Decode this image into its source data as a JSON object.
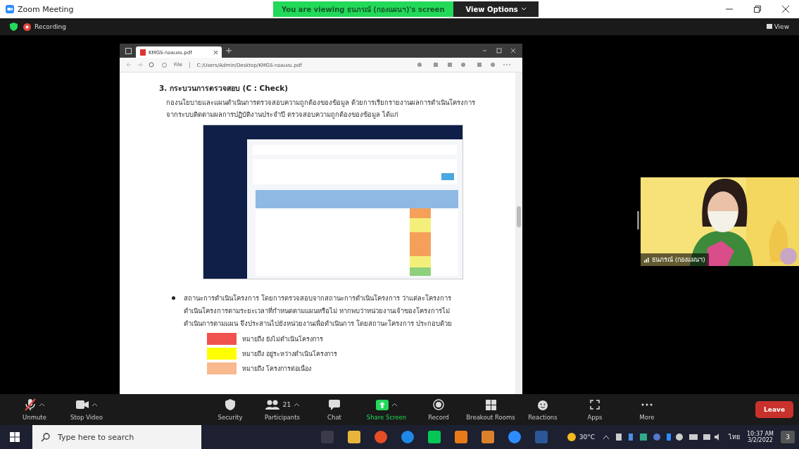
{
  "window": {
    "title": "Zoom Meeting"
  },
  "banner": {
    "text": "You are viewing ธนภรณ์ (กองแผนฯ)'s screen",
    "view_options": "View Options"
  },
  "recording": {
    "label": "Recording",
    "on": true
  },
  "view_button": "View",
  "shared_browser": {
    "tab_title": "KMGS-กองแผน.pdf",
    "address_prefix": "File",
    "address": "C:/Users/Admin/Desktop/KMGS-กองแผน.pdf",
    "document": {
      "heading": "3. กระบวนการตรวจสอบ (C : Check)",
      "paragraph_lines": [
        "กองนโยบายและแผนดำเนินการตรวจสอบความถูกต้องของข้อมูล ด้วยการเรียกรายงานผลการดำเนินโครงการ",
        "จากระบบติดตามผลการปฏิบัติงานประจำปี ตรวจสอบความถูกต้องของข้อมูล ได้แก่"
      ],
      "figure": {
        "kind": "picture"
      },
      "bullet_lines": [
        "สถานะการดำเนินโครงการ โดยการตรวจสอบจากสถานะการดำเนินโครงการ ว่าแต่ละโครงการ",
        "ดำเนินโครงการตามระยะเวลาที่กำหนดตามแผนหรือไม่ หากพบว่าหน่วยงานเจ้าของโครงการไม่",
        "ดำเนินการตามแผน จึงประสานไปยังหน่วยงานเพื่อดำเนินการ โดยสถานะโครงการ ประกอบด้วย"
      ],
      "legend": [
        {
          "color": "#f0524f",
          "label": "หมายถึง ยังไม่ดำเนินโครงการ"
        },
        {
          "color": "#ffff00",
          "label": "หมายถึง อยู่ระหว่างดำเนินโครงการ"
        },
        {
          "color": "#f9b98e",
          "label": "หมายถึง โครงการต่อเนื่อง"
        }
      ]
    }
  },
  "video_tile": {
    "name": "ธนภรณ์ (กองแผนฯ)"
  },
  "toolbar": [
    {
      "kind": "mic",
      "label": "Unmute",
      "muted": true,
      "caret": true
    },
    {
      "kind": "video",
      "label": "Stop Video",
      "caret": true
    },
    {
      "kind": "security",
      "label": "Security"
    },
    {
      "kind": "participants",
      "label": "Participants",
      "count": "21",
      "caret": true
    },
    {
      "kind": "chat",
      "label": "Chat"
    },
    {
      "kind": "share",
      "label": "Share Screen",
      "caret": true
    },
    {
      "kind": "record",
      "label": "Record"
    },
    {
      "kind": "breakout",
      "label": "Breakout Rooms"
    },
    {
      "kind": "reactions",
      "label": "Reactions"
    },
    {
      "kind": "apps",
      "label": "Apps"
    },
    {
      "kind": "more",
      "label": "More"
    }
  ],
  "leave": "Leave",
  "taskbar": {
    "search_placeholder": "Type here to search",
    "apps": [
      {
        "color": "#3a3a4a",
        "kind": "task"
      },
      {
        "color": "#e8b53a",
        "kind": "folder"
      },
      {
        "color": "#e44d26",
        "kind": "chrome"
      },
      {
        "color": "#1e88e5",
        "kind": "edge"
      },
      {
        "color": "#06c755",
        "kind": "line"
      },
      {
        "color": "#e97a18",
        "kind": "app"
      },
      {
        "color": "#d9822b",
        "kind": "app"
      },
      {
        "color": "#2d8cff",
        "kind": "zoom"
      },
      {
        "color": "#2b5797",
        "kind": "word"
      }
    ],
    "weather": "30°C",
    "language": "ไทย",
    "time": "10:37 AM",
    "date": "3/2/2022",
    "notifications": "3"
  }
}
